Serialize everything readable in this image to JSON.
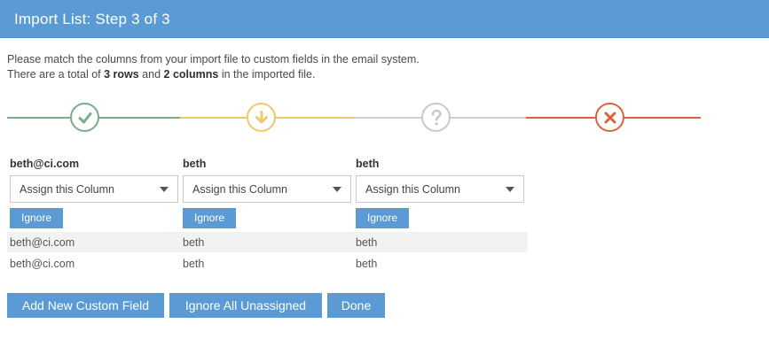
{
  "dialog": {
    "title": "Import List: Step 3 of 3"
  },
  "intro": {
    "line1": "Please match the columns from your import file to custom fields in the email system.",
    "line2_prefix": "There are a total of ",
    "row_count": "3 rows",
    "line2_and": " and ",
    "col_count": "2 columns",
    "line2_suffix": " in the imported file."
  },
  "stepper": {
    "steps": [
      {
        "icon": "check-icon",
        "color": "#7aab8d"
      },
      {
        "icon": "arrow-down-icon",
        "color": "#f0c86b"
      },
      {
        "icon": "question-icon",
        "color": "#c9c9c9"
      },
      {
        "icon": "x-icon",
        "color": "#d9633f"
      }
    ]
  },
  "columns": [
    {
      "header": "beth@ci.com",
      "select_value": "Assign this Column",
      "ignore_label": "Ignore"
    },
    {
      "header": "beth",
      "select_value": "Assign this Column",
      "ignore_label": "Ignore"
    },
    {
      "header": "beth",
      "select_value": "Assign this Column",
      "ignore_label": "Ignore"
    }
  ],
  "rows": [
    [
      "beth@ci.com",
      "beth",
      "beth"
    ],
    [
      "beth@ci.com",
      "beth",
      "beth"
    ]
  ],
  "actions": {
    "add_field": "Add New Custom Field",
    "ignore_all": "Ignore All Unassigned",
    "done": "Done"
  }
}
